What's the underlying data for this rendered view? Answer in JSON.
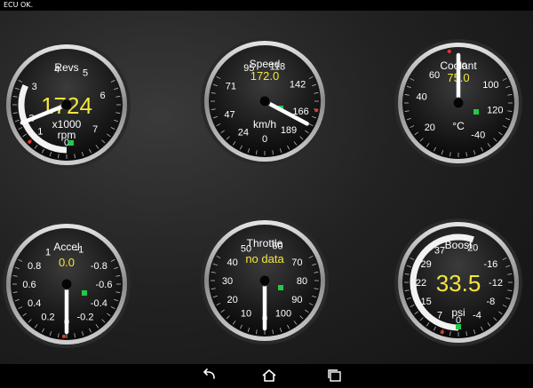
{
  "status": {
    "text": "ECU OK."
  },
  "colors": {
    "value": "#f5e53b",
    "label": "#ffffff",
    "needle": "#ffffff",
    "indicator": "#22c94a",
    "redline": "#e23b2b",
    "bezel": "#b9b9b9"
  },
  "gauges": [
    {
      "id": "revs",
      "name": "Revs",
      "value": "1724",
      "unit": "x1000\nrpm",
      "unit_lines": [
        "x1000",
        "rpm"
      ],
      "ticks": [
        "0",
        "1",
        "2",
        "3",
        "4",
        "5",
        "6",
        "7"
      ],
      "min": 0,
      "max": 7,
      "reading": 1.724,
      "arc": true,
      "redline": 2.2
    },
    {
      "id": "speed",
      "name": "Speed",
      "value": "172.0",
      "unit_lines": [
        "km/h"
      ],
      "ticks": [
        "0",
        "24",
        "47",
        "71",
        "95",
        "118",
        "142",
        "166",
        "189"
      ],
      "min": 0,
      "max": 189,
      "reading": 172
    },
    {
      "id": "coolant",
      "name": "Coolant",
      "value": "75.0",
      "unit_lines": [
        "°C"
      ],
      "ticks": [
        "-40",
        "120",
        "100",
        "80",
        "60",
        "40",
        "20"
      ],
      "min": -40,
      "max": 120,
      "reading": 75,
      "reverse": true
    },
    {
      "id": "accel",
      "name": "Accel",
      "value": "0.0",
      "unit_lines": [],
      "ticks": [
        "0",
        "0.2",
        "0.4",
        "0.6",
        "0.8",
        "1",
        "-1",
        "-0.8",
        "-0.6",
        "-0.4",
        "-0.2"
      ],
      "min": 0,
      "max": 1,
      "reading": 0
    },
    {
      "id": "throttle",
      "name": "Throttle",
      "value": "no data",
      "unit_lines": [],
      "ticks": [
        "0",
        "10",
        "20",
        "30",
        "40",
        "50",
        "60",
        "70",
        "80",
        "90",
        "100"
      ],
      "min": 0,
      "max": 100,
      "reading": 0
    },
    {
      "id": "boost",
      "name": "Boost",
      "value": "33.5",
      "unit_lines": [
        "psi"
      ],
      "ticks": [
        "0",
        "7",
        "15",
        "22",
        "29",
        "37",
        "-20",
        "-16",
        "-12",
        "-8",
        "-4"
      ],
      "min": 0,
      "max": 37,
      "reading": 33.5,
      "arc": true
    }
  ],
  "nav": {
    "back": "back-icon",
    "home": "home-icon",
    "recents": "recents-icon"
  }
}
